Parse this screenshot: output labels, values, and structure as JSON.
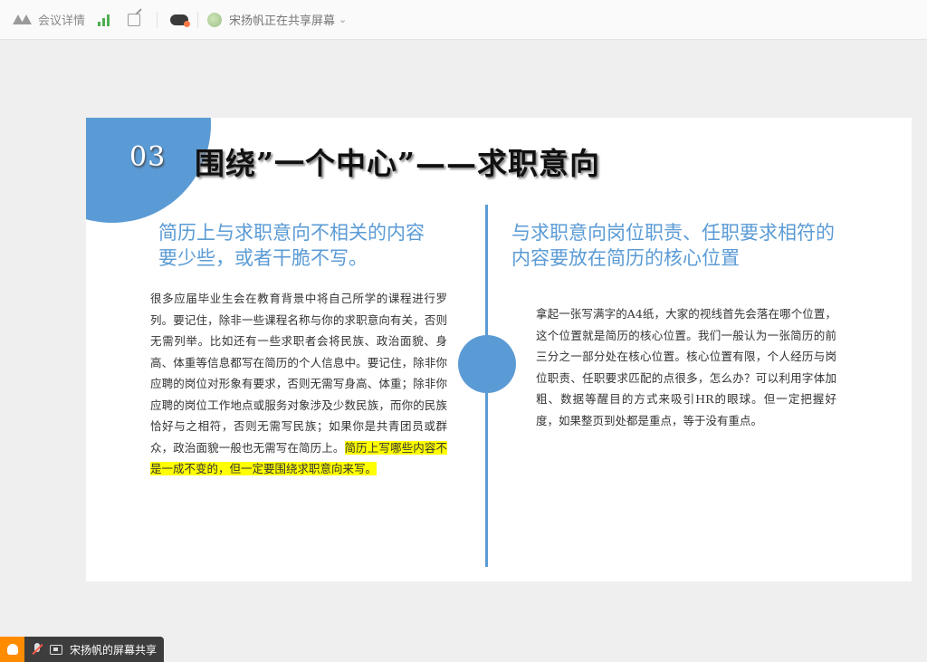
{
  "toolbar": {
    "meeting_details_label": "会议详情",
    "sharer_label": "宋扬帆正在共享屏幕",
    "signal_color": "#4caf50"
  },
  "slide": {
    "section_number": "03",
    "section_title": "围绕”一个中心”——求职意向",
    "left_heading_line1": "简历上与求职意向不相关的内容",
    "left_heading_line2": "要少些，或者干脆不写。",
    "left_body": "很多应届毕业生会在教育背景中将自己所学的课程进行罗列。要记住，除非一些课程名称与你的求职意向有关，否则无需列举。比如还有一些求职者会将民族、政治面貌、身高、体重等信息都写在简历的个人信息中。要记住，除非你应聘的岗位对形象有要求，否则无需写身高、体重；除非你应聘的岗位工作地点或服务对象涉及少数民族，而你的民族恰好与之相符，否则无需写民族；如果你是共青团员或群众，政治面貌一般也无需写在简历上。",
    "left_body_highlight": "简历上写哪些内容不是一成不变的，但一定要围绕求职意向来写。",
    "right_heading_line1": "与求职意向岗位职责、任职要求相符的",
    "right_heading_line2": "内容要放在简历的核心位置",
    "right_body": "拿起一张写满字的A4纸，大家的视线首先会落在哪个位置，这个位置就是简历的核心位置。我们一般认为一张简历的前三分之一部分处在核心位置。核心位置有限，个人经历与岗位职责、任职要求匹配的点很多，怎么办？可以利用字体加粗、数据等醒目的方式来吸引HR的眼球。但一定把握好度，如果整页到处都是重点，等于没有重点。",
    "accent_color": "#5b9bd5",
    "highlight_color": "#ffff00"
  },
  "status_bar": {
    "screen_share_label": "宋扬帆的屏幕共享"
  }
}
